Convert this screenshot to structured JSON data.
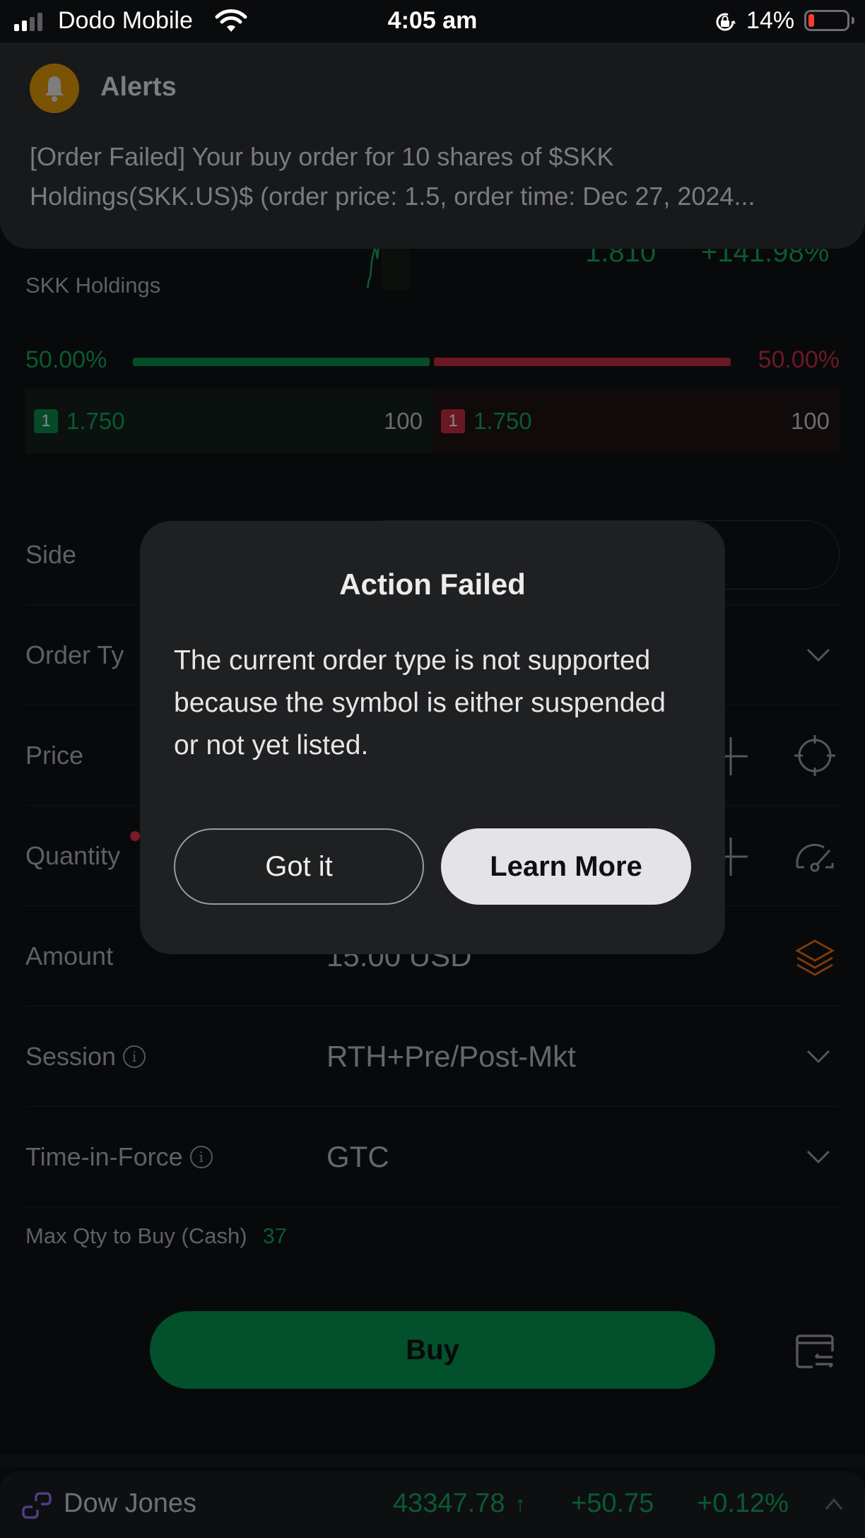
{
  "status_bar": {
    "carrier": "Dodo Mobile",
    "time": "4:05 am",
    "battery_percent": "14%",
    "battery_level_fraction": 0.14,
    "icons": [
      "signal-icon",
      "wifi-icon",
      "rotation-lock-icon",
      "battery-icon"
    ]
  },
  "alert": {
    "icon": "bell-icon",
    "title": "Alerts",
    "message": "[Order Failed] Your buy order for 10 shares of $SKK Holdings(SKK.US)$ (order price: 1.5, order time: Dec 27, 2024..."
  },
  "stock": {
    "name": "SKK Holdings",
    "price": "1.810",
    "change_pct": "+141.98%"
  },
  "order_book": {
    "bid_ratio": "50.00%",
    "ask_ratio": "50.00%",
    "bid_ratio_value": 0.5,
    "ask_ratio_value": 0.5,
    "bid": {
      "level": "1",
      "price": "1.750",
      "qty": "100"
    },
    "ask": {
      "level": "1",
      "price": "1.750",
      "qty": "100"
    }
  },
  "form": {
    "side_label": "Side",
    "order_type_label": "Order Ty",
    "price_label": "Price",
    "quantity_label": "Quantity",
    "amount_label": "Amount",
    "amount_value": "15.00 USD",
    "session_label": "Session",
    "session_value": "RTH+Pre/Post-Mkt",
    "tif_label": "Time-in-Force",
    "tif_value": "GTC",
    "max_qty_label": "Max Qty to Buy (Cash)",
    "max_qty_value": "37",
    "info_glyph": "i"
  },
  "buy_button": "Buy",
  "ticker": {
    "name": "Dow Jones",
    "value": "43347.78",
    "arrow": "↑",
    "change": "+50.75",
    "change_pct": "+0.12%"
  },
  "modal": {
    "title": "Action Failed",
    "body": "The current order type is not supported because the symbol is either suspended or not yet listed.",
    "got_it": "Got it",
    "learn_more": "Learn More"
  },
  "colors": {
    "up_green": "#0a5a32",
    "down_red": "#6a1822",
    "buy_green": "#02502c",
    "alert_accent": "#7a5404",
    "amount_icon": "#7a3a0a"
  }
}
